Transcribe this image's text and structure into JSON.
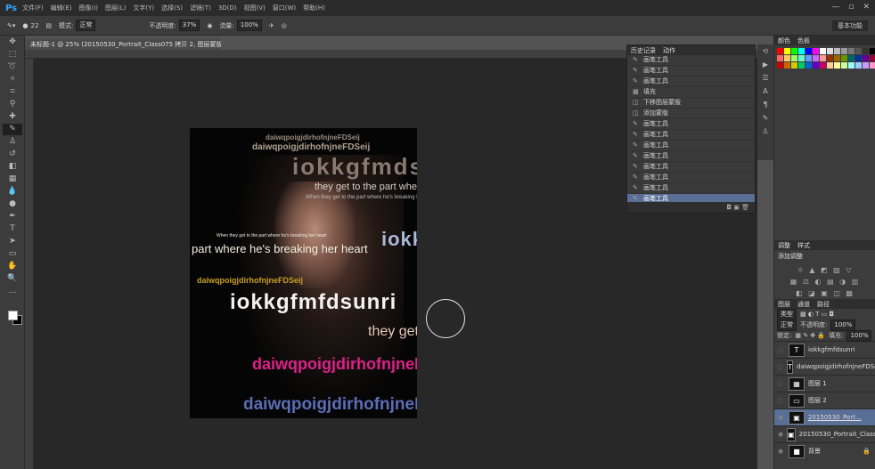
{
  "app": {
    "logo": "Ps"
  },
  "menu": [
    "文件(F)",
    "编辑(E)",
    "图像(I)",
    "图层(L)",
    "文字(Y)",
    "选择(S)",
    "滤镜(T)",
    "3D(D)",
    "视图(V)",
    "窗口(W)",
    "帮助(H)"
  ],
  "window_controls": [
    "—",
    "▫",
    "✕"
  ],
  "options_bar": {
    "brush_size": "22",
    "mode_label": "模式:",
    "mode_value": "正常",
    "opacity_label": "不透明度:",
    "opacity_value": "37%",
    "flow_label": "流量:",
    "flow_value": "100%",
    "workspace": "基本功能"
  },
  "document": {
    "tab_title": "未标题-1 @ 25% (20150530_Portrait_Class075 拷贝 2, 图层蒙版/8) * ×"
  },
  "artwork_text": {
    "line1": "daiwqpoigjdirhofnjneFDSeij",
    "line2": "iokkgfmdsunri",
    "line3": "they get to the part where he's bre",
    "line4": "When they get to the part where he's breaking her heart",
    "line5": "part where he's breaking her heart",
    "line6": "iokkgfmdsunri",
    "line7": "daiwqpoigjdirhofnjneFDSeij",
    "line8": "iokkgfmfdsunri",
    "line9": "they get to th",
    "line10": "daiwqpoigjdirhofnjneFDSeij",
    "line11": "daiwqpoigjdirhofnjneFDSeij"
  },
  "history": {
    "tabs": [
      "历史记录",
      "动作"
    ],
    "items": [
      "画笔工具",
      "画笔工具",
      "画笔工具",
      "填充",
      "下移图层蒙版",
      "添加蒙版",
      "画笔工具",
      "画笔工具",
      "画笔工具",
      "画笔工具",
      "画笔工具",
      "画笔工具",
      "画笔工具",
      "画笔工具"
    ],
    "selected_index": 13
  },
  "swatches_panel": {
    "tabs": [
      "颜色",
      "色板"
    ]
  },
  "swatch_colors": [
    "#ff0000",
    "#ffff00",
    "#00ff00",
    "#00ffff",
    "#0000ff",
    "#ff00ff",
    "#ffffff",
    "#dddddd",
    "#bbbbbb",
    "#999999",
    "#777777",
    "#555555",
    "#333333",
    "#000000",
    "#ff6666",
    "#ffcc66",
    "#99ff66",
    "#66ffcc",
    "#6699ff",
    "#cc66ff",
    "#ff9999",
    "#993300",
    "#996600",
    "#669900",
    "#006666",
    "#003399",
    "#660099",
    "#990033",
    "#cc0000",
    "#cc6600",
    "#cccc00",
    "#00cc66",
    "#0066cc",
    "#6600cc",
    "#cc0066",
    "#ffcc99",
    "#ffff99",
    "#ccff99",
    "#99ffff",
    "#99ccff",
    "#cc99ff",
    "#ff99cc"
  ],
  "adjustments": {
    "tabs": [
      "调整",
      "样式"
    ],
    "label": "添加调整"
  },
  "layers": {
    "tabs": [
      "图层",
      "通道",
      "路径"
    ],
    "kind": "类型",
    "blend": "正常",
    "opacity_label": "不透明度:",
    "opacity_value": "100%",
    "lock_label": "锁定:",
    "fill_label": "填充:",
    "fill_value": "100%",
    "items": [
      {
        "name": "iokkgfmfdsunri",
        "thumb": "T",
        "selected": false
      },
      {
        "name": "daiwqpoigjdirhofnjneFDSeij",
        "thumb": "T",
        "selected": false
      },
      {
        "name": "图层 1",
        "thumb": "▦",
        "selected": false
      },
      {
        "name": "图层 2",
        "thumb": "▭",
        "selected": false
      },
      {
        "name": "20150530_Port...",
        "thumb": "▣",
        "selected": true
      },
      {
        "name": "20150530_Portrait_Class...",
        "thumb": "▣",
        "selected": false
      },
      {
        "name": "背景",
        "thumb": "■",
        "selected": false
      }
    ]
  }
}
